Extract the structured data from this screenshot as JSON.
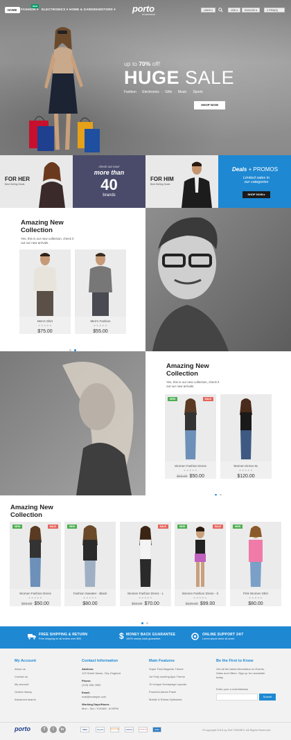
{
  "nav": {
    "home": "HOME",
    "fashion": "FASHION ▾",
    "fashion_badge": "NEW",
    "electronics": "ELECTRONICS ▾",
    "home_garden": "HOME & GARDEN",
    "motors": "MOTORS ▾",
    "links": "LINKS ▾",
    "currency": "USD ▾",
    "language": "ENGLISH ▾",
    "cart": "0 ITEM(S)"
  },
  "logo": {
    "name": "porto",
    "tagline": "eCommerce"
  },
  "hero": {
    "subtitle_pre": "up to ",
    "subtitle_pct": "70%",
    "subtitle_post": " off!",
    "title_bold": "HUGE",
    "title_light": "SALE",
    "categories": "Fashion  ·  Electronics  ·  Gifts  ·  Music  ·  Sports",
    "shop_button": "SHOP NOW"
  },
  "promos": [
    {
      "title": "FOR HER",
      "sub": "Best Selling Deals"
    },
    {
      "line1": "check out now!",
      "line2": "more than",
      "number": "40",
      "line3": "brands"
    },
    {
      "title": "FOR HIM",
      "sub": "Best Selling Deals"
    },
    {
      "title_bold": "Deals",
      "title_light": " + PROMOS",
      "sub1": "Limited sales in",
      "sub2": "our categories",
      "button": "SHOP NOW ▸"
    }
  ],
  "section1": {
    "title1": "Amazing New",
    "title2": "Collection",
    "sub1": "Yes, this is our new collection, check it",
    "sub2": "out our new arrivals.",
    "products": [
      {
        "name": "Men's Shirt",
        "price": "$75.00"
      },
      {
        "name": "Men's Fashion",
        "price": "$55.00"
      }
    ]
  },
  "section2": {
    "title1": "Amazing New",
    "title2": "Collection",
    "sub1": "Yes, this is our new collection, check it",
    "sub2": "out our new arrivals.",
    "products": [
      {
        "name": "Women Fashion Dress",
        "old": "$60.00",
        "price": "$50.00",
        "new": "NEW",
        "sale": "SALE"
      },
      {
        "name": "Women Dress-XL",
        "price": "$120.00"
      }
    ]
  },
  "section3": {
    "title1": "Amazing New",
    "title2": "Collection",
    "products": [
      {
        "name": "Women Fashion Dress",
        "old": "$60.00",
        "price": "$50.00",
        "new": "NEW",
        "sale": "SALE"
      },
      {
        "name": "Fashion Sweater - Black",
        "price": "$80.00",
        "new": "NEW"
      },
      {
        "name": "Women Fashion Dress - L",
        "old": "$90.00",
        "price": "$70.00",
        "sale": "SALE"
      },
      {
        "name": "Women Fashion Dress - S",
        "old": "$120.00",
        "price": "$99.00",
        "new": "NEW",
        "sale": "SALE"
      },
      {
        "name": "Pink Women Shirt",
        "price": "$80.00",
        "new": "NEW"
      }
    ]
  },
  "features": [
    {
      "title": "FREE SHIPPING & RETURN",
      "sub": "Free shipping on all orders over $99."
    },
    {
      "title": "MONEY BACK GUARANTEE",
      "sub": "100% money back guarantee."
    },
    {
      "title": "ONLINE SUPPORT 24/7",
      "sub": "Lorem ipsum dolor sit amet."
    }
  ],
  "footer": {
    "account_title": "My Account",
    "account_links": [
      "About us",
      "Contact us",
      "My account",
      "Orders history",
      "Advanced search"
    ],
    "contact_title": "Contact Information",
    "address_label": "Address:",
    "address": "123 Street Name, City, England",
    "phone_label": "Phone:",
    "phone": "(123) 456-7890",
    "email_label": "Email:",
    "email": "mail@example.com",
    "hours_label": "Working Days/Hours:",
    "hours": "Mon - Sun / 9:00AM - 8:00PM",
    "features_title": "Main Features",
    "features_links": [
      "Super Fast Magento Theme",
      "1st Fully working Ajax Theme",
      "10 Unique Homepage Layouts",
      "Powerful Admin Panel",
      "Mobile & Retina Optimized"
    ],
    "newsletter_title": "Be the First to Know",
    "newsletter_text1": "Get all the latest information on Events,",
    "newsletter_text2": "Sales and Offers. Sign up for newsletter",
    "newsletter_text3": "today.",
    "email_placeholder": "Enter your e-mail Address",
    "submit": "Submit",
    "copyright": "©Copyright 2015 by SW-THEMES. All Rights Reserved.",
    "payments": [
      "VISA",
      "PayPal",
      "DISCOVER",
      "CIRRUS",
      "mastercard",
      "AMEX"
    ]
  },
  "colors": {
    "accent": "#1e88d2",
    "dark_promo": "#4a4b6a",
    "new_badge": "#4caf50",
    "sale_badge": "#e5645b"
  }
}
